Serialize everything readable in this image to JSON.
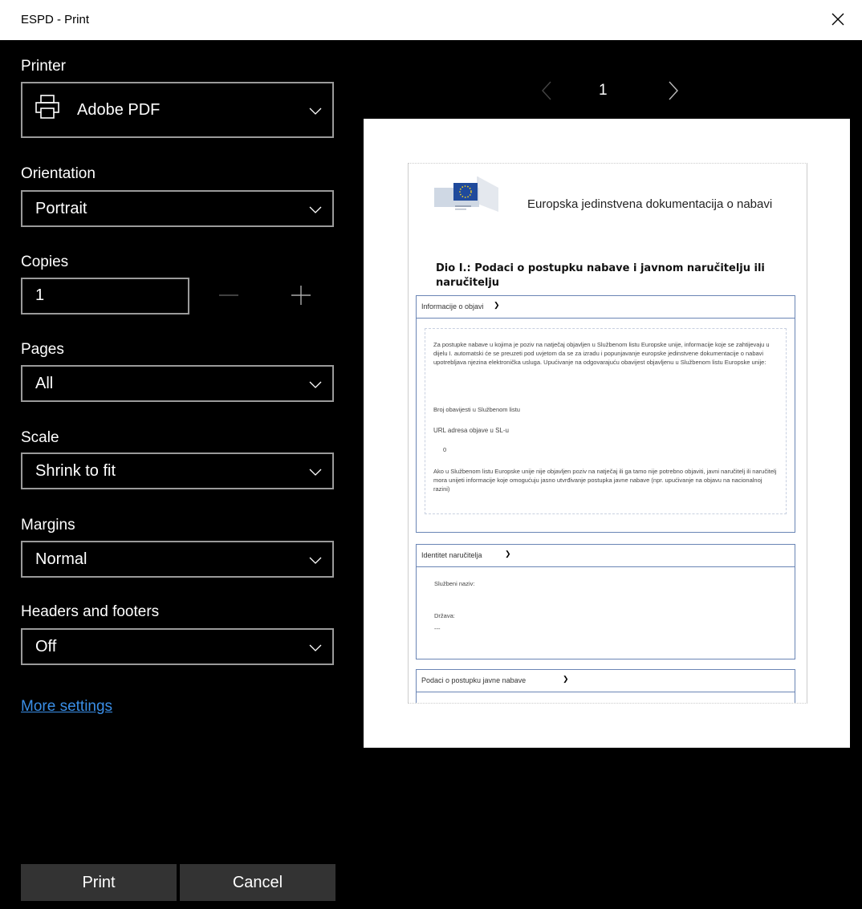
{
  "window": {
    "title": "ESPD - Print"
  },
  "settings": {
    "printer": {
      "label": "Printer",
      "value": "Adobe PDF"
    },
    "orientation": {
      "label": "Orientation",
      "value": "Portrait"
    },
    "copies": {
      "label": "Copies",
      "value": "1"
    },
    "pages": {
      "label": "Pages",
      "value": "All"
    },
    "scale": {
      "label": "Scale",
      "value": "Shrink to fit"
    },
    "margins": {
      "label": "Margins",
      "value": "Normal"
    },
    "headers_footers": {
      "label": "Headers and footers",
      "value": "Off"
    },
    "more_settings": "More settings"
  },
  "actions": {
    "print": "Print",
    "cancel": "Cancel"
  },
  "preview": {
    "page_number": "1",
    "doc_title": "Europska jedinstvena dokumentacija o nabavi",
    "part_title": "Dio I.: Podaci o postupku nabave i javnom naručitelju ili naručitelju",
    "section1": {
      "header": "Informacije o objavi",
      "para1": "Za postupke nabave u kojima je poziv na natječaj objavljen u Službenom listu Europske unije, informacije koje se zahtijevaju u dijelu I. automatski će se preuzeti pod uvjetom da se za izradu i popunjavanje europske jedinstvene dokumentacije o nabavi upotrebljava njezina elektronička usluga. Upućivanje na odgovarajuću obavijest objavljenu u Službenom listu Europske unije:",
      "notice_no": "Broj obavijesti u Službenom listu",
      "url_label": "URL adresa objave u SL-u",
      "url_value": "0",
      "para2": "Ako u Službenom listu Europske unije nije objavljen poziv na natječaj ili ga tamo nije potrebno objaviti, javni naručitelj ili naručitelj mora unijeti informacije koje omogućuju jasno utvrđivanje postupka javne nabave (npr. upućivanje na objavu na nacionalnoj razini)"
    },
    "section2": {
      "header": "Identitet naručitelja",
      "official_name": "Službeni naziv:",
      "country": "Država:",
      "country_value": "---"
    },
    "section3": {
      "header": "Podaci o postupku javne nabave"
    }
  }
}
